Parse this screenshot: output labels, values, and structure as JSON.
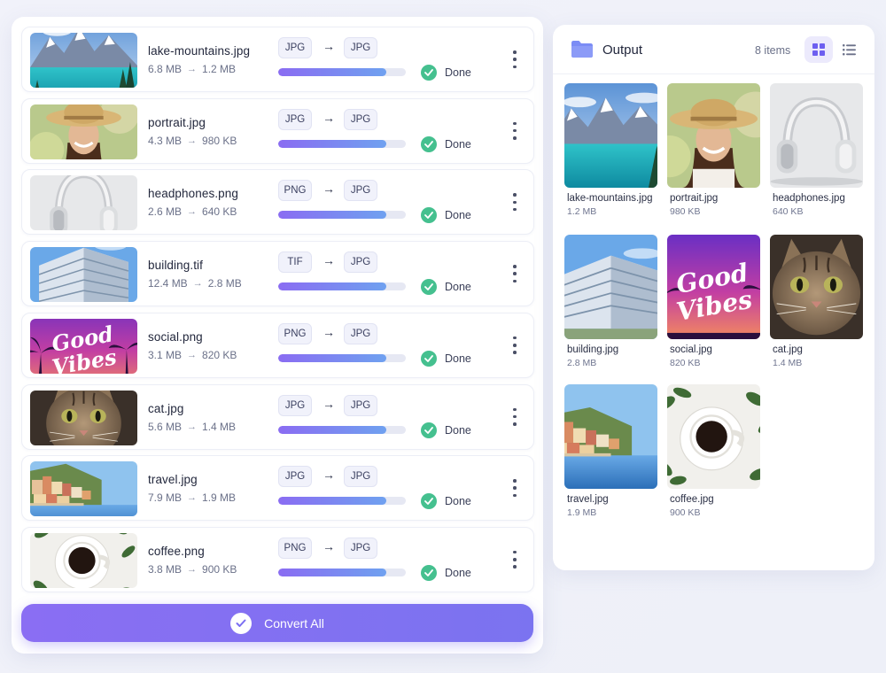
{
  "files": [
    {
      "name": "lake-mountains.jpg",
      "size_before": "6.8 MB",
      "size_after": "1.2 MB",
      "from": "JPG",
      "to": "JPG",
      "progress": 0.85,
      "status": "Done",
      "thumb": "lake-icon"
    },
    {
      "name": "portrait.jpg",
      "size_before": "4.3 MB",
      "size_after": "980 KB",
      "from": "JPG",
      "to": "JPG",
      "progress": 0.85,
      "status": "Done",
      "thumb": "portrait-icon"
    },
    {
      "name": "headphones.png",
      "size_before": "2.6 MB",
      "size_after": "640 KB",
      "from": "PNG",
      "to": "JPG",
      "progress": 0.85,
      "status": "Done",
      "thumb": "headphones-icon"
    },
    {
      "name": "building.tif",
      "size_before": "12.4 MB",
      "size_after": "2.8 MB",
      "from": "TIF",
      "to": "JPG",
      "progress": 0.85,
      "status": "Done",
      "thumb": "building-icon"
    },
    {
      "name": "social.png",
      "size_before": "3.1 MB",
      "size_after": "820 KB",
      "from": "PNG",
      "to": "JPG",
      "progress": 0.85,
      "status": "Done",
      "thumb": "good-vibes-icon"
    },
    {
      "name": "cat.jpg",
      "size_before": "5.6 MB",
      "size_after": "1.4 MB",
      "from": "JPG",
      "to": "JPG",
      "progress": 0.85,
      "status": "Done",
      "thumb": "cat-icon"
    },
    {
      "name": "travel.jpg",
      "size_before": "7.9 MB",
      "size_after": "1.9 MB",
      "from": "JPG",
      "to": "JPG",
      "progress": 0.85,
      "status": "Done",
      "thumb": "travel-icon"
    },
    {
      "name": "coffee.png",
      "size_before": "3.8 MB",
      "size_after": "900 KB",
      "from": "PNG",
      "to": "JPG",
      "progress": 0.85,
      "status": "Done",
      "thumb": "coffee-icon"
    }
  ],
  "convert_button": {
    "label": "Convert All"
  },
  "output": {
    "title": "Output",
    "count": "8 items",
    "view_mode": "grid",
    "items": [
      {
        "name": "lake-mountains.jpg",
        "size": "1.2 MB"
      },
      {
        "name": "portrait.jpg",
        "size": "980 KB"
      },
      {
        "name": "headphones.jpg",
        "size": "640 KB"
      },
      {
        "name": "building.jpg",
        "size": "2.8 MB"
      },
      {
        "name": "social.jpg",
        "size": "820 KB"
      },
      {
        "name": "cat.jpg",
        "size": "1.4 MB"
      },
      {
        "name": "travel.jpg",
        "size": "1.9 MB"
      },
      {
        "name": "coffee.jpg",
        "size": "900 KB"
      }
    ]
  },
  "colors": {
    "accent": "#7b6ef2",
    "success": "#45c08f",
    "folder": "#7b8cf5"
  },
  "icons": {
    "arrow": "→",
    "convert_check": "check-icon",
    "folder": "folder-icon",
    "grid_view": "grid-icon",
    "list_view": "list-icon",
    "more": "kebab-icon"
  }
}
